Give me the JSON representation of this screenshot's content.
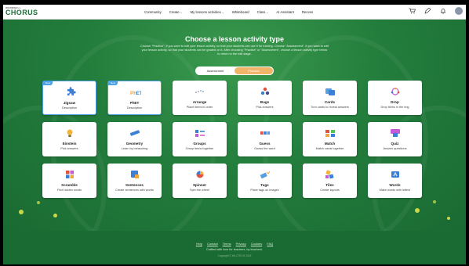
{
  "app": {
    "logo_small": "WORDWALL",
    "logo_main": "CHORUS"
  },
  "nav": [
    {
      "label": "Community",
      "dropdown": false
    },
    {
      "label": "Create",
      "dropdown": true
    },
    {
      "label": "My lessons activities",
      "dropdown": true
    },
    {
      "label": "Whiteboard",
      "dropdown": false
    },
    {
      "label": "Class",
      "dropdown": true
    },
    {
      "label": "AI Assistant",
      "dropdown": false
    },
    {
      "label": "Recess",
      "dropdown": false
    }
  ],
  "header": {
    "title": "Choose a lesson activity type",
    "description": "Choose \"Practice\", if you want to edit your lesson activity, so that your students can use it for training. Choose \"Assessment\", if you want to edit your lesson activity, so that your students can be graded on it. After choosing \"Practice\" or \"Assessment\", choose a lesson activity type below to return to the edit stage."
  },
  "mode_toggle": {
    "options": [
      "Assessment",
      "Practice"
    ],
    "selected": "Practice",
    "accent": "#f1b56a"
  },
  "badge_label": "New",
  "activities": [
    {
      "name": "Jigsaw",
      "sub": "Description",
      "icon": "puzzle-icon",
      "new": true,
      "selected": true
    },
    {
      "name": "PhET",
      "sub": "Description",
      "icon": "phet-logo",
      "new": true,
      "selected": true
    },
    {
      "name": "Arrange",
      "sub": "Place items in order",
      "icon": "arrange-icon",
      "new": false
    },
    {
      "name": "Bugs",
      "sub": "Pick answers",
      "icon": "bugs-icon",
      "new": false
    },
    {
      "name": "Cards",
      "sub": "Turn cards to reveal answers",
      "icon": "cards-icon",
      "new": false
    },
    {
      "name": "Drop",
      "sub": "Drop items in the ring",
      "icon": "drop-icon",
      "new": false
    },
    {
      "name": "Einstein",
      "sub": "Pick answers",
      "icon": "bulb-icon",
      "new": false
    },
    {
      "name": "Geometry",
      "sub": "Learn by measuring",
      "icon": "ruler-icon",
      "new": false
    },
    {
      "name": "Groups",
      "sub": "Group items together",
      "icon": "groups-icon",
      "new": false
    },
    {
      "name": "Guess",
      "sub": "Guess the word",
      "icon": "guess-icon",
      "new": false
    },
    {
      "name": "Match",
      "sub": "Match cards together",
      "icon": "match-icon",
      "new": false
    },
    {
      "name": "Quiz",
      "sub": "Answer questions",
      "icon": "quiz-icon",
      "new": false
    },
    {
      "name": "Scramble",
      "sub": "Find hidden words",
      "icon": "scramble-icon",
      "new": false
    },
    {
      "name": "Sentences",
      "sub": "Create sentences with words",
      "icon": "sentences-icon",
      "new": false
    },
    {
      "name": "Spinner",
      "sub": "Spin the wheel",
      "icon": "spinner-icon",
      "new": false
    },
    {
      "name": "Tags",
      "sub": "Place tags on images",
      "icon": "tags-icon",
      "new": false
    },
    {
      "name": "Tiles",
      "sub": "Create layouts",
      "icon": "tiles-icon",
      "new": false
    },
    {
      "name": "Words",
      "sub": "Make words with letters",
      "icon": "words-icon",
      "new": false
    }
  ],
  "footer": {
    "links": [
      "Help",
      "Contact",
      "Terms",
      "Privacy",
      "Cookies",
      "FAQ"
    ],
    "crafted": "Crafted with love for teachers, by teachers.",
    "copyright": "Copyright © WLCTECH 2024"
  },
  "colors": {
    "brand_green": "#1e7a3a",
    "selected_border": "#4da3e6"
  }
}
